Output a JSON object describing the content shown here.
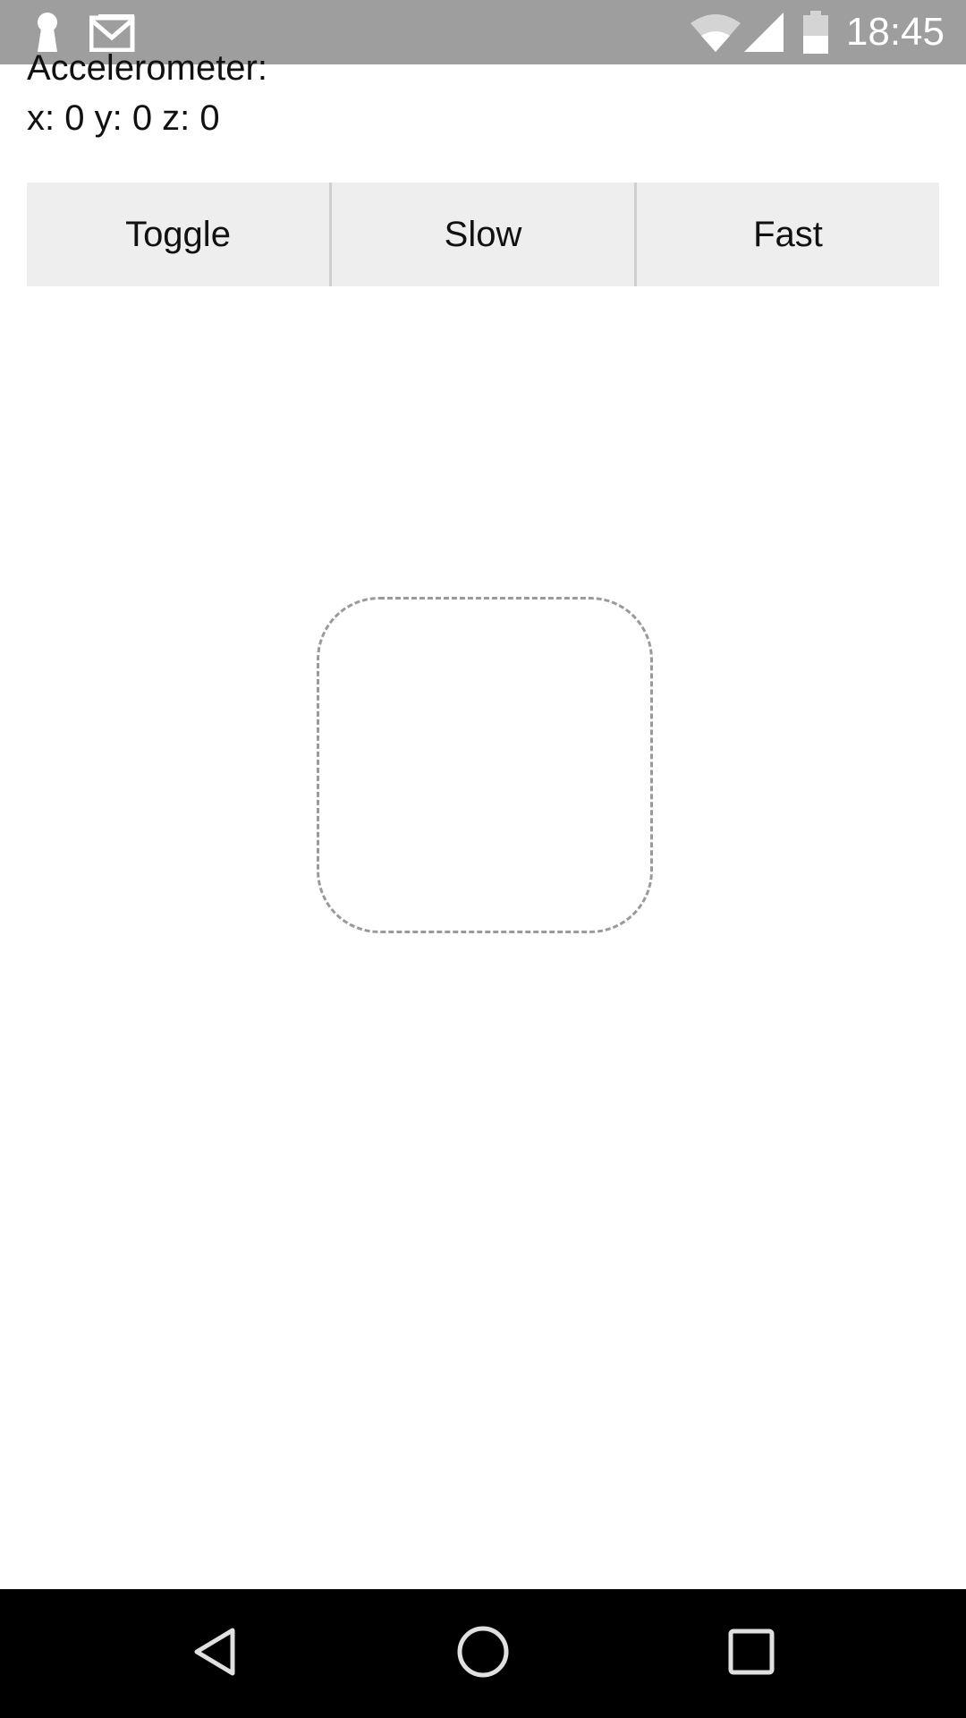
{
  "status_bar": {
    "time": "18:45",
    "icons": [
      "keyhole-icon",
      "gmail-icon",
      "wifi-icon",
      "signal-icon",
      "battery-icon"
    ]
  },
  "accelerometer": {
    "label": "Accelerometer:",
    "values": "x: 0 y: 0 z: 0"
  },
  "buttons": {
    "toggle_label": "Toggle",
    "slow_label": "Slow",
    "fast_label": "Fast"
  },
  "nav_bar": {
    "icons": [
      "back-icon",
      "home-icon",
      "recents-icon"
    ]
  },
  "colors": {
    "status_bar_bg": "#9e9e9e",
    "button_bg": "#eeeeee",
    "nav_bar_bg": "#000000",
    "drop_box_border": "#9a9a9a"
  }
}
